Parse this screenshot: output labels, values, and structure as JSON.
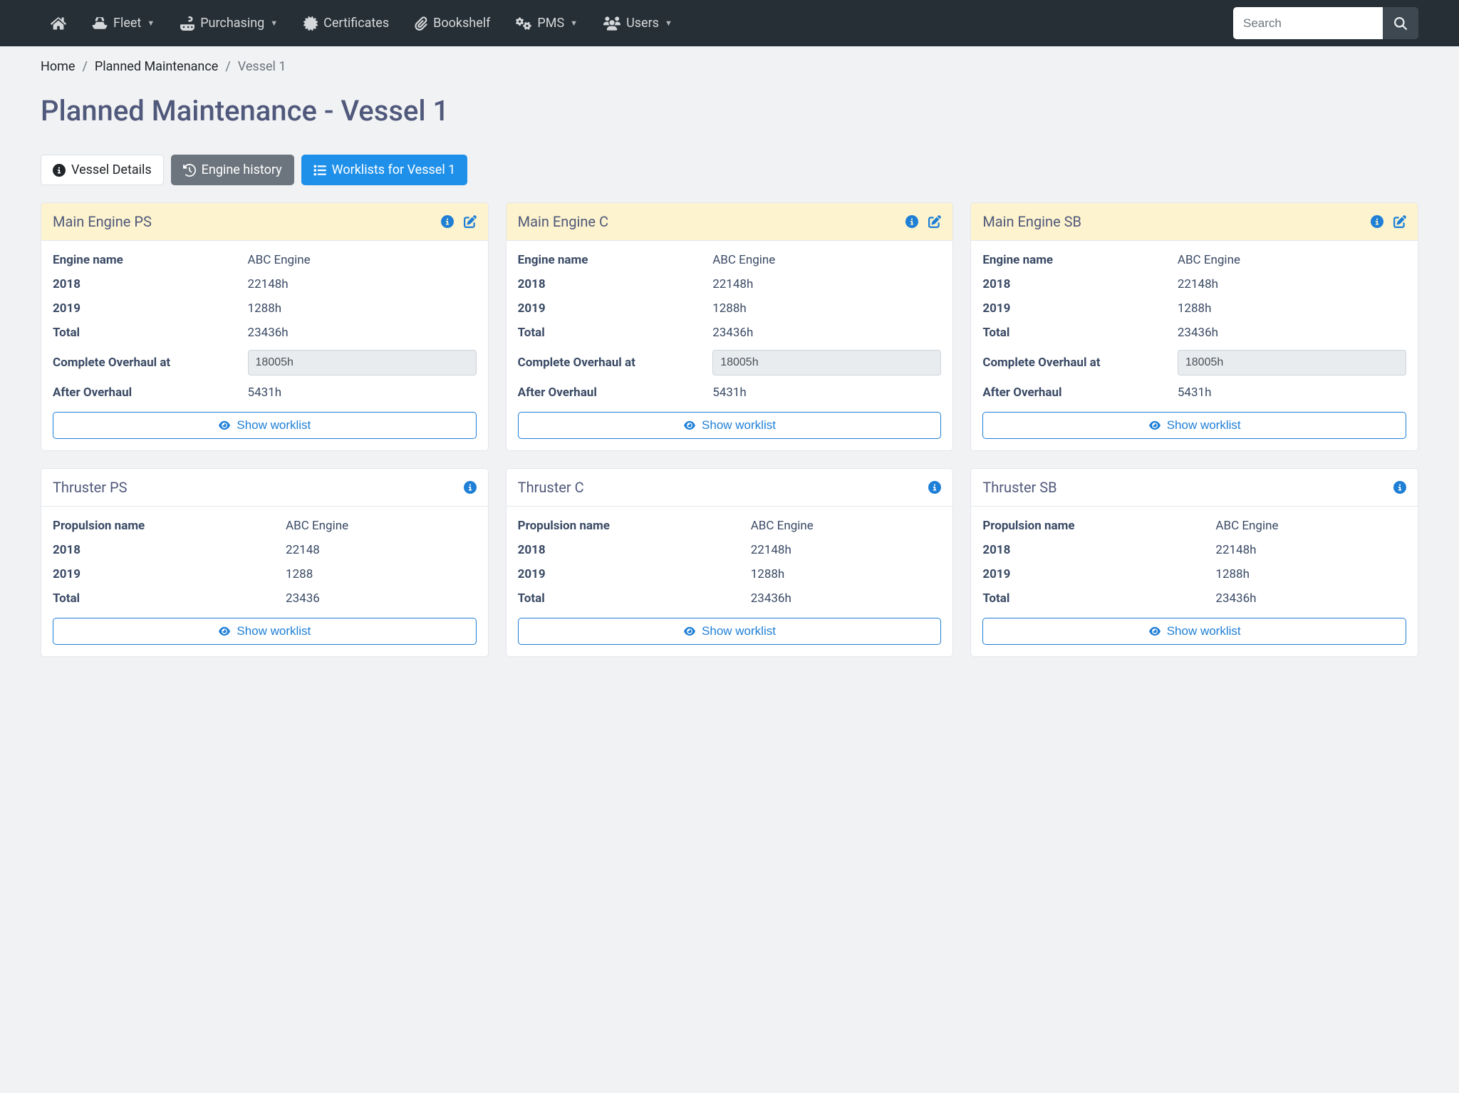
{
  "nav": {
    "items": [
      {
        "label": "Fleet"
      },
      {
        "label": "Purchasing"
      },
      {
        "label": "Certificates"
      },
      {
        "label": "Bookshelf"
      },
      {
        "label": "PMS"
      },
      {
        "label": "Users"
      }
    ],
    "search_placeholder": "Search"
  },
  "breadcrumb": {
    "home": "Home",
    "section": "Planned Maintenance",
    "current": "Vessel 1"
  },
  "page_title": "Planned Maintenance - Vessel 1",
  "tabs": {
    "details": "Vessel Details",
    "history": "Engine history",
    "worklists": "Worklists for Vessel 1"
  },
  "labels": {
    "engine_name": "Engine name",
    "propulsion_name": "Propulsion name",
    "y2018": "2018",
    "y2019": "2019",
    "total": "Total",
    "complete_overhaul_at": "Complete Overhaul at",
    "after_overhaul": "After Overhaul",
    "show_worklist": "Show worklist"
  },
  "engines": [
    {
      "title": "Main Engine PS",
      "engine_name": "ABC Engine",
      "y2018": "22148h",
      "y2019": "1288h",
      "total": "23436h",
      "overhaul_at": "18005h",
      "after_overhaul": "5431h"
    },
    {
      "title": "Main Engine C",
      "engine_name": "ABC Engine",
      "y2018": "22148h",
      "y2019": "1288h",
      "total": "23436h",
      "overhaul_at": "18005h",
      "after_overhaul": "5431h"
    },
    {
      "title": "Main Engine SB",
      "engine_name": "ABC Engine",
      "y2018": "22148h",
      "y2019": "1288h",
      "total": "23436h",
      "overhaul_at": "18005h",
      "after_overhaul": "5431h"
    }
  ],
  "thrusters": [
    {
      "title": "Thruster PS",
      "propulsion_name": "ABC Engine",
      "y2018": "22148",
      "y2019": "1288",
      "total": "23436"
    },
    {
      "title": "Thruster C",
      "propulsion_name": "ABC Engine",
      "y2018": "22148h",
      "y2019": "1288h",
      "total": "23436h"
    },
    {
      "title": "Thruster SB",
      "propulsion_name": "ABC Engine",
      "y2018": "22148h",
      "y2019": "1288h",
      "total": "23436h"
    }
  ]
}
